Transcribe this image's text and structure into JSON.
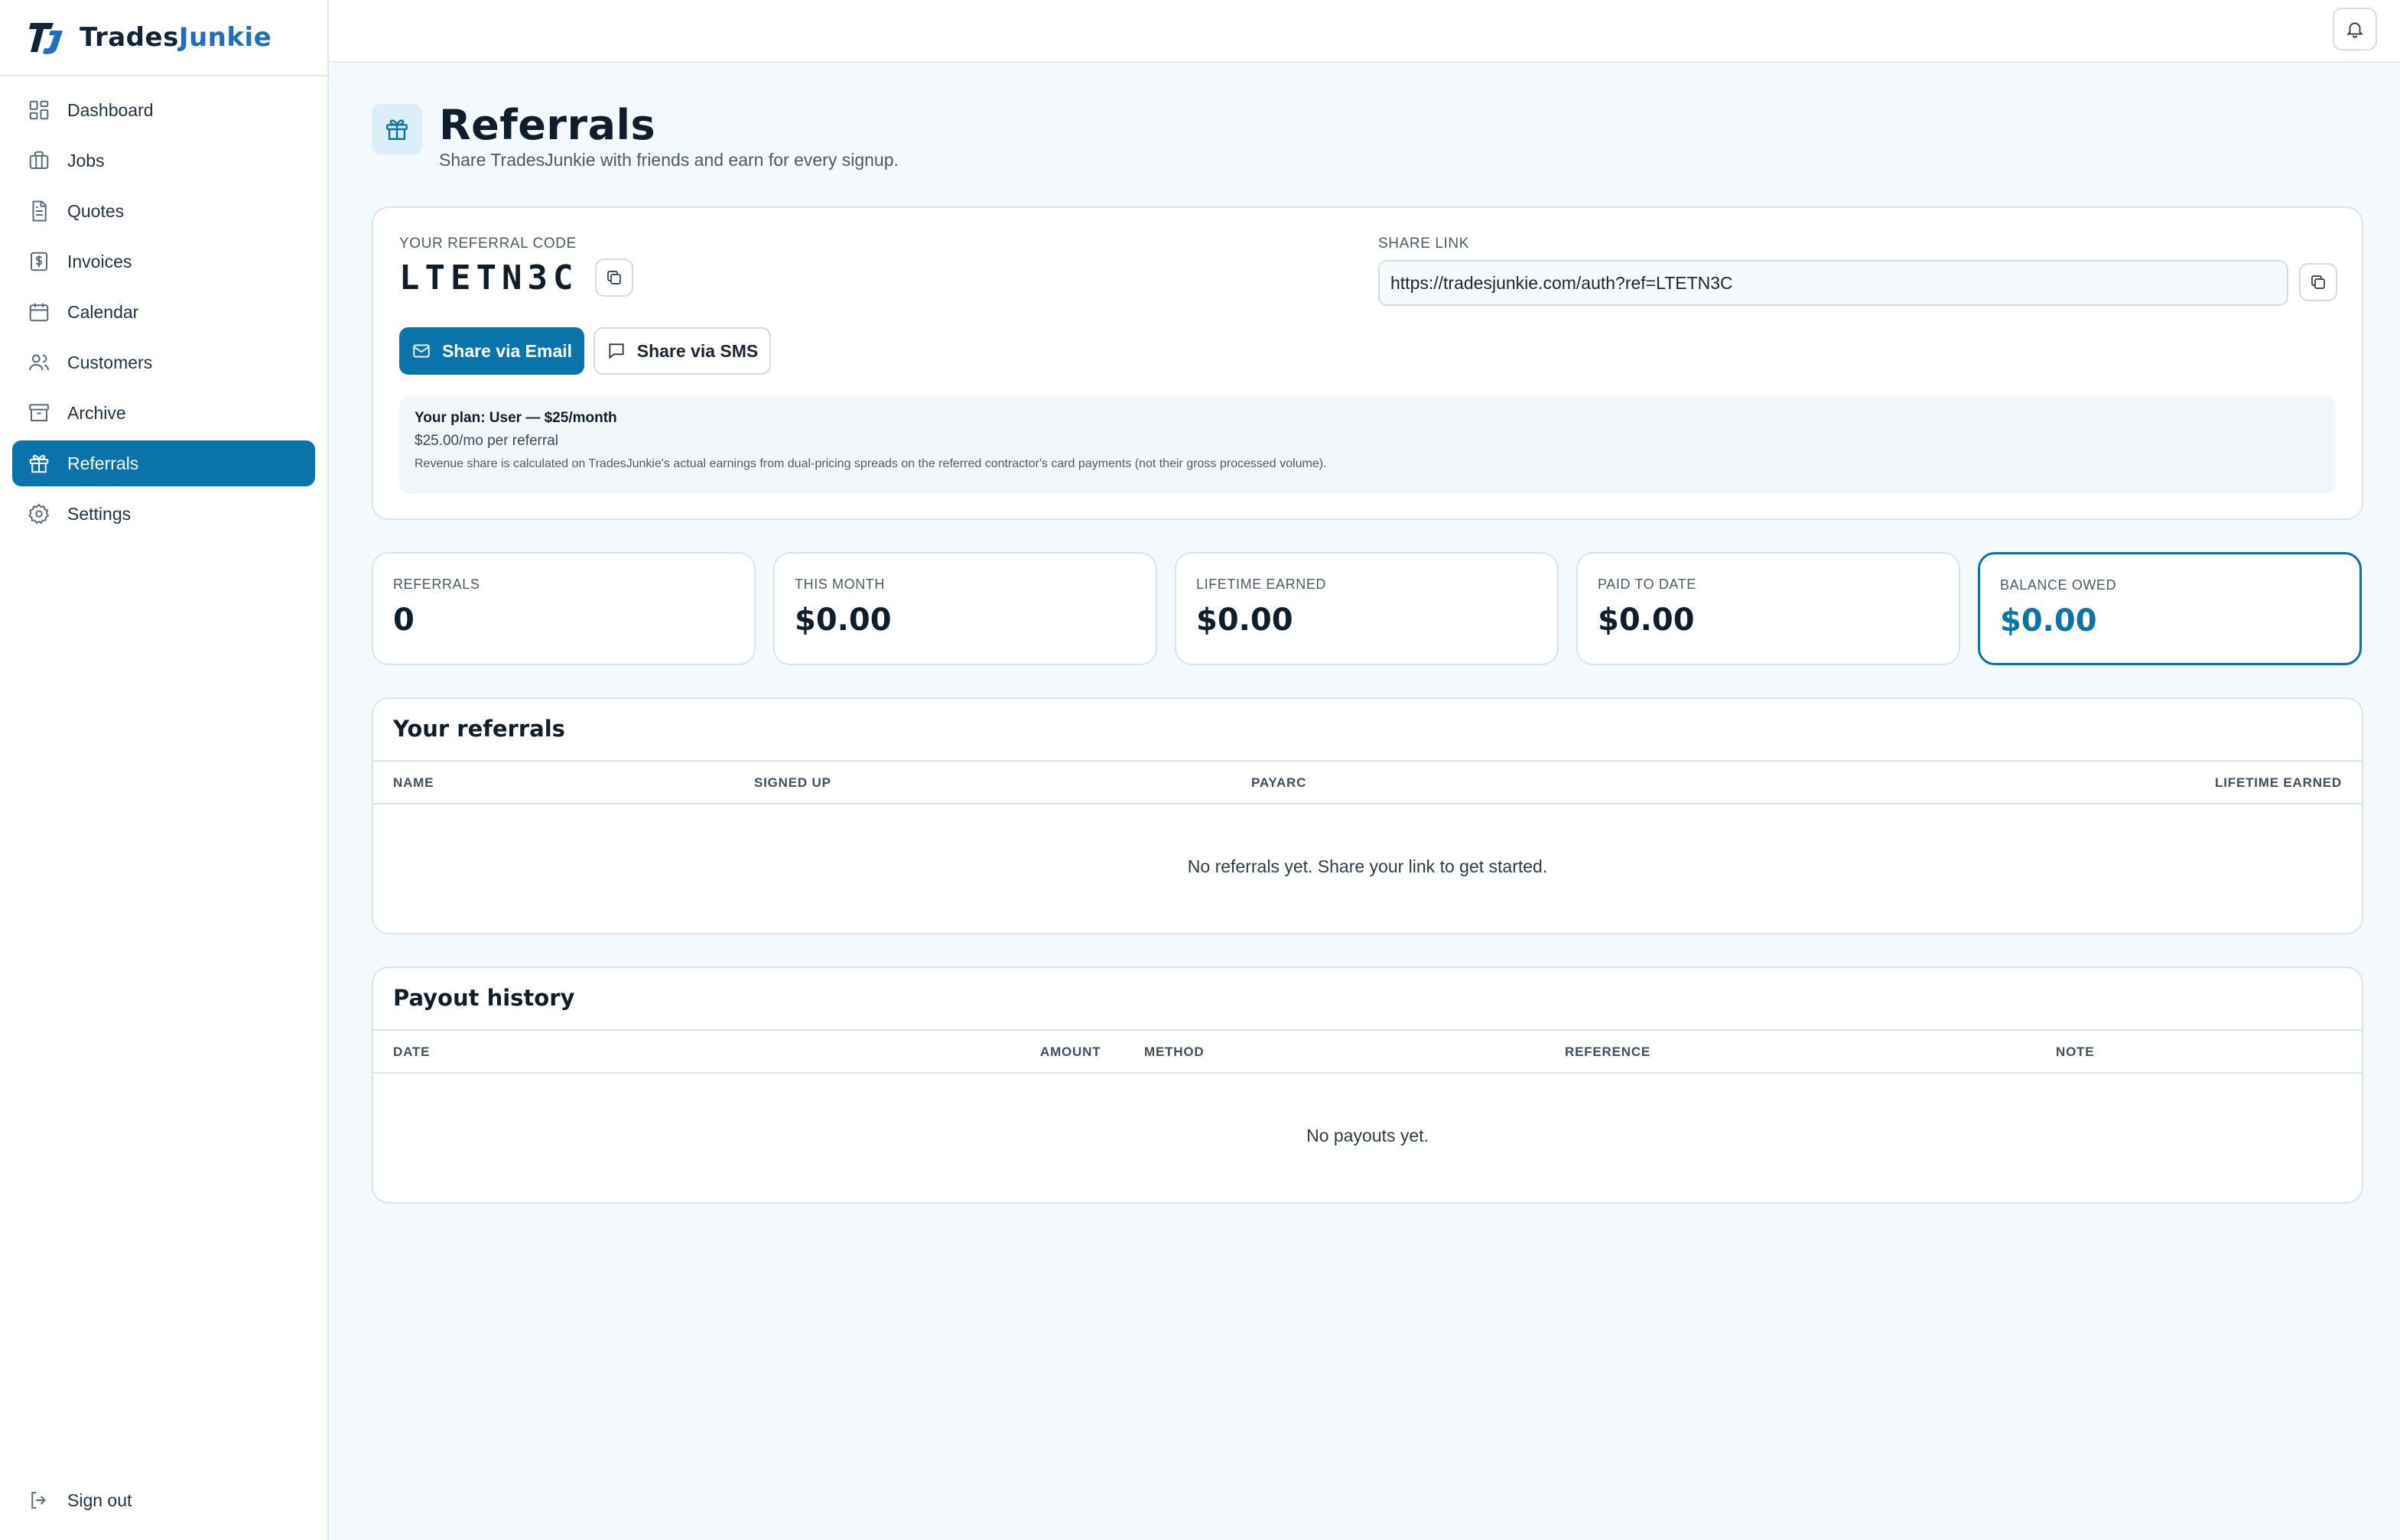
{
  "brand": {
    "name_part1": "Trades",
    "name_part2": "Junkie",
    "logo_icon": "tj-monogram-icon"
  },
  "sidebar": {
    "items": [
      {
        "label": "Dashboard",
        "icon": "grid-icon"
      },
      {
        "label": "Jobs",
        "icon": "briefcase-icon"
      },
      {
        "label": "Quotes",
        "icon": "document-icon"
      },
      {
        "label": "Invoices",
        "icon": "dollar-receipt-icon"
      },
      {
        "label": "Calendar",
        "icon": "calendar-icon"
      },
      {
        "label": "Customers",
        "icon": "users-icon"
      },
      {
        "label": "Archive",
        "icon": "archive-icon"
      },
      {
        "label": "Referrals",
        "icon": "gift-icon",
        "active": true
      },
      {
        "label": "Settings",
        "icon": "gear-icon"
      }
    ],
    "signout": "Sign out"
  },
  "header": {
    "title": "Referrals",
    "subtitle": "Share TradesJunkie with friends and earn for every signup."
  },
  "referral": {
    "code_label": "YOUR REFERRAL CODE",
    "code": "LTETN3C",
    "share_label": "SHARE LINK",
    "share_link": "https://tradesjunkie.com/auth?ref=LTETN3C",
    "email_button": "Share via Email",
    "sms_button": "Share via SMS",
    "plan_title": "Your plan: User — $25/month",
    "plan_rate": "$25.00/mo per referral",
    "plan_note": "Revenue share is calculated on TradesJunkie's actual earnings from dual-pricing spreads on the referred contractor's card payments (not their gross processed volume)."
  },
  "stats": [
    {
      "label": "REFERRALS",
      "value": "0"
    },
    {
      "label": "THIS MONTH",
      "value": "$0.00"
    },
    {
      "label": "LIFETIME EARNED",
      "value": "$0.00"
    },
    {
      "label": "PAID TO DATE",
      "value": "$0.00"
    },
    {
      "label": "BALANCE OWED",
      "value": "$0.00"
    }
  ],
  "referrals_table": {
    "title": "Your referrals",
    "columns": [
      "NAME",
      "SIGNED UP",
      "PAYARC",
      "LIFETIME EARNED"
    ],
    "empty": "No referrals yet. Share your link to get started."
  },
  "payouts_table": {
    "title": "Payout history",
    "columns": [
      "DATE",
      "AMOUNT",
      "METHOD",
      "REFERENCE",
      "NOTE"
    ],
    "empty": "No payouts yet."
  },
  "colors": {
    "accent": "#0a74aa",
    "brand_blue": "#1d6fc6",
    "background": "#f3f9fc"
  }
}
